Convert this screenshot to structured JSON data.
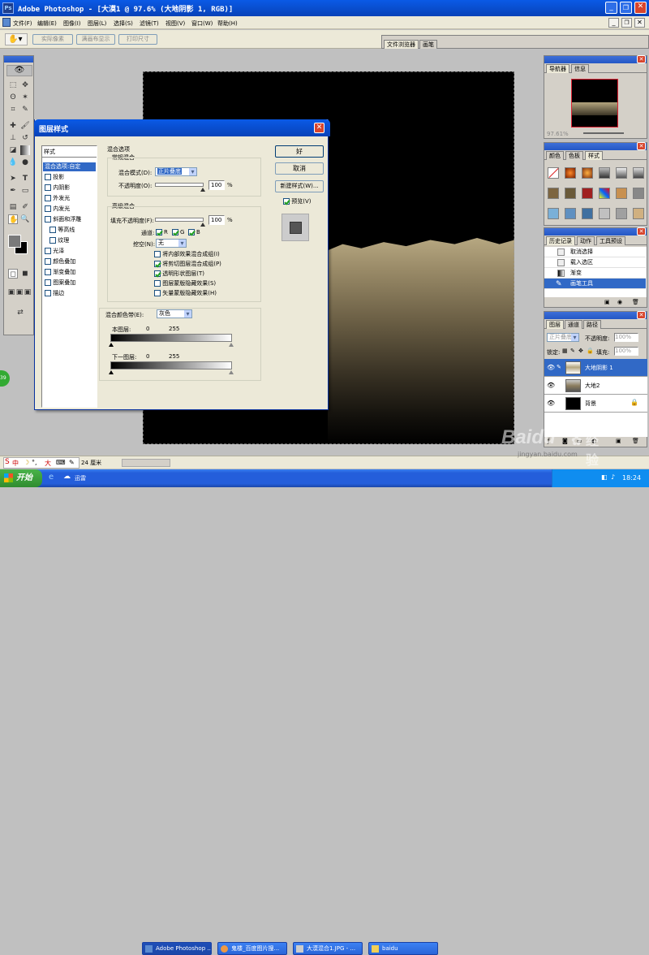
{
  "app": {
    "title": "Adobe Photoshop - [大漠1 @ 97.6% (大地阴影 1, RGB)]",
    "ps_badge": "Ps"
  },
  "menu": [
    "文件(F)",
    "编辑(E)",
    "图像(I)",
    "图层(L)",
    "选择(S)",
    "滤镜(T)",
    "视图(V)",
    "窗口(W)",
    "帮助(H)"
  ],
  "options_bar": {
    "buttons": [
      "实际像素",
      "满画布显示",
      "打印尺寸"
    ],
    "well_tabs": [
      "文件浏览器",
      "画笔"
    ]
  },
  "dialog": {
    "title": "图层样式",
    "styles_header": "样式",
    "styles": [
      {
        "label": "混合选项:自定",
        "checked": null,
        "active": true
      },
      {
        "label": "投影",
        "checked": false
      },
      {
        "label": "内阴影",
        "checked": false
      },
      {
        "label": "外发光",
        "checked": false
      },
      {
        "label": "内发光",
        "checked": false
      },
      {
        "label": "斜面和浮雕",
        "checked": false
      },
      {
        "label": "等高线",
        "checked": false,
        "indent": true
      },
      {
        "label": "纹理",
        "checked": false,
        "indent": true
      },
      {
        "label": "光泽",
        "checked": false
      },
      {
        "label": "颜色叠加",
        "checked": false
      },
      {
        "label": "渐变叠加",
        "checked": false
      },
      {
        "label": "图案叠加",
        "checked": false
      },
      {
        "label": "描边",
        "checked": false
      }
    ],
    "blend_options_title": "混合选项",
    "general_blending": "常规混合",
    "blend_mode_label": "混合模式(D):",
    "blend_mode_value": "正片叠底",
    "opacity_label": "不透明度(O):",
    "opacity_value": "100",
    "percent": "%",
    "advanced_blending": "高级混合",
    "fill_opacity_label": "填充不透明度(F):",
    "fill_opacity_value": "100",
    "channels_label": "通道:",
    "channel_r": "R",
    "channel_g": "G",
    "channel_b": "B",
    "knockout_label": "挖空(N):",
    "knockout_value": "无",
    "adv_options": [
      {
        "label": "将内部效果混合成组(I)",
        "checked": false
      },
      {
        "label": "将剪切图层混合成组(P)",
        "checked": true
      },
      {
        "label": "透明形状图层(T)",
        "checked": true
      },
      {
        "label": "图层蒙版隐藏效果(S)",
        "checked": false
      },
      {
        "label": "矢量蒙版隐藏效果(H)",
        "checked": false
      }
    ],
    "blend_if_label": "混合颜色带(E):",
    "blend_if_value": "灰色",
    "this_layer_label": "本图层:",
    "this_layer_min": "0",
    "this_layer_max": "255",
    "underlying_label": "下一图层:",
    "underlying_min": "0",
    "underlying_max": "255",
    "ok": "好",
    "cancel": "取消",
    "new_style": "新建样式(W)...",
    "preview": "预览(V)",
    "preview_checked": true
  },
  "navigator": {
    "tabs": [
      "导航器",
      "信息"
    ],
    "zoom": "97.61%"
  },
  "color_panel": {
    "tabs": [
      "颜色",
      "色板",
      "样式"
    ]
  },
  "history": {
    "tabs": [
      "历史记录",
      "动作",
      "工具预设"
    ],
    "items": [
      "取消选择",
      "载入选区",
      "渐变",
      "画笔工具"
    ],
    "active_index": 3
  },
  "layers": {
    "tabs": [
      "图层",
      "通道",
      "路径"
    ],
    "blend_mode": "正片叠底",
    "opacity_label": "不透明度:",
    "opacity": "100%",
    "lock_label": "锁定:",
    "fill_label": "填充:",
    "fill": "100%",
    "items": [
      {
        "name": "大地阴影 1",
        "active": true
      },
      {
        "name": "大地2",
        "active": false
      },
      {
        "name": "背景",
        "active": false
      }
    ]
  },
  "status": {
    "zoom": "24 厘米"
  },
  "taskbar": {
    "start": "开始",
    "items": [
      {
        "label": "迅雷",
        "active": false
      },
      {
        "label": "Adobe Photoshop ...",
        "active": true
      },
      {
        "label": "鬼楼_百度图片搜...",
        "active": false
      },
      {
        "label": "大漠混合1.JPG - ...",
        "active": false
      },
      {
        "label": "baidu",
        "active": false
      }
    ],
    "time": "18:24",
    "ime": "中",
    "ime_extra": "大"
  },
  "watermark": {
    "brand": "Baidu",
    "sub": "经验",
    "url": "jingyan.baidu.com"
  },
  "colors": {
    "xp_blue": "#2457c5",
    "selection": "#3169c6",
    "sand": "#8c7d5e"
  }
}
